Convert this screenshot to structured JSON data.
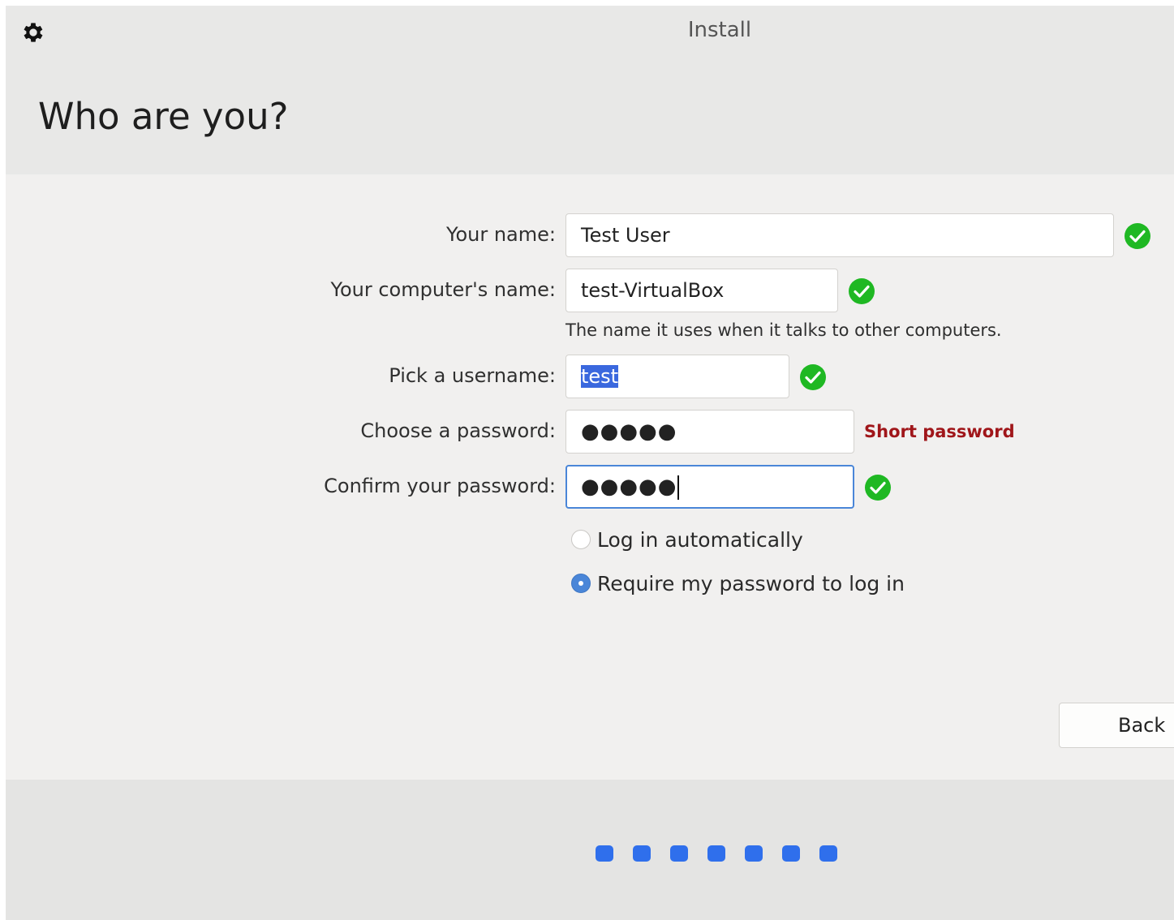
{
  "window": {
    "title": "Install",
    "settings_icon": "gear-icon"
  },
  "page": {
    "heading": "Who are you?"
  },
  "form": {
    "your_name": {
      "label": "Your name:",
      "value": "Test User",
      "status_icon": "check-icon"
    },
    "computer_name": {
      "label": "Your computer's name:",
      "value": "test-VirtualBox",
      "hint": "The name it uses when it talks to other computers.",
      "status_icon": "check-icon"
    },
    "username": {
      "label": "Pick a username:",
      "value": "test",
      "status_icon": "check-icon"
    },
    "password": {
      "label": "Choose a password:",
      "masked_value": "●●●●●",
      "warning": "Short password"
    },
    "confirm_password": {
      "label": "Confirm your password:",
      "masked_value": "●●●●●",
      "status_icon": "check-icon"
    },
    "login_options": [
      {
        "label": "Log in automatically",
        "selected": false
      },
      {
        "label": "Require my password to log in",
        "selected": true
      }
    ]
  },
  "buttons": {
    "back": "Back"
  },
  "colors": {
    "accent": "#4a86d8",
    "success": "#1fb823",
    "warning": "#a0161a",
    "progress_dot": "#2f6fec"
  },
  "progress": {
    "total_steps": 7
  }
}
